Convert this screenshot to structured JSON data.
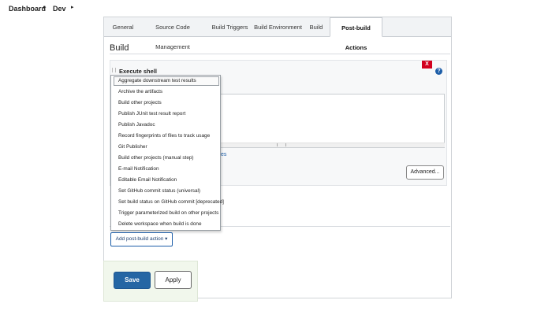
{
  "breadcrumb": {
    "items": [
      "Dashboard",
      "Dev"
    ],
    "separator": "▸"
  },
  "tabs": [
    {
      "label": "General",
      "active": false
    },
    {
      "label": "Source Code Management",
      "active": false
    },
    {
      "label": "Build Triggers",
      "active": false
    },
    {
      "label": "Build Environment",
      "active": false
    },
    {
      "label": "Build",
      "active": false
    },
    {
      "label": "Post-build Actions",
      "active": true
    }
  ],
  "build_section": {
    "title": "Build",
    "step_title": "Execute shell",
    "delete_label": "X",
    "help_label": "?",
    "env_link_fragment": "es",
    "advanced_label": "Advanced..."
  },
  "post_build_menu": {
    "items": [
      "Aggregate downstream test results",
      "Archive the artifacts",
      "Build other projects",
      "Publish JUnit test result report",
      "Publish Javadoc",
      "Record fingerprints of files to track usage",
      "Git Publisher",
      "Build other projects (manual step)",
      "E-mail Notification",
      "Editable Email Notification",
      "Set GitHub commit status (universal)",
      "Set build status on GitHub commit [deprecated]",
      "Trigger parameterized build on other projects",
      "Delete workspace when build is done"
    ],
    "highlighted_index": 0,
    "add_button_label": "Add post-build action ▾"
  },
  "footer": {
    "save_label": "Save",
    "apply_label": "Apply"
  },
  "colors": {
    "accent": "#2566a4",
    "delete": "#d2001e",
    "save_bar": "#f1f7ec"
  }
}
